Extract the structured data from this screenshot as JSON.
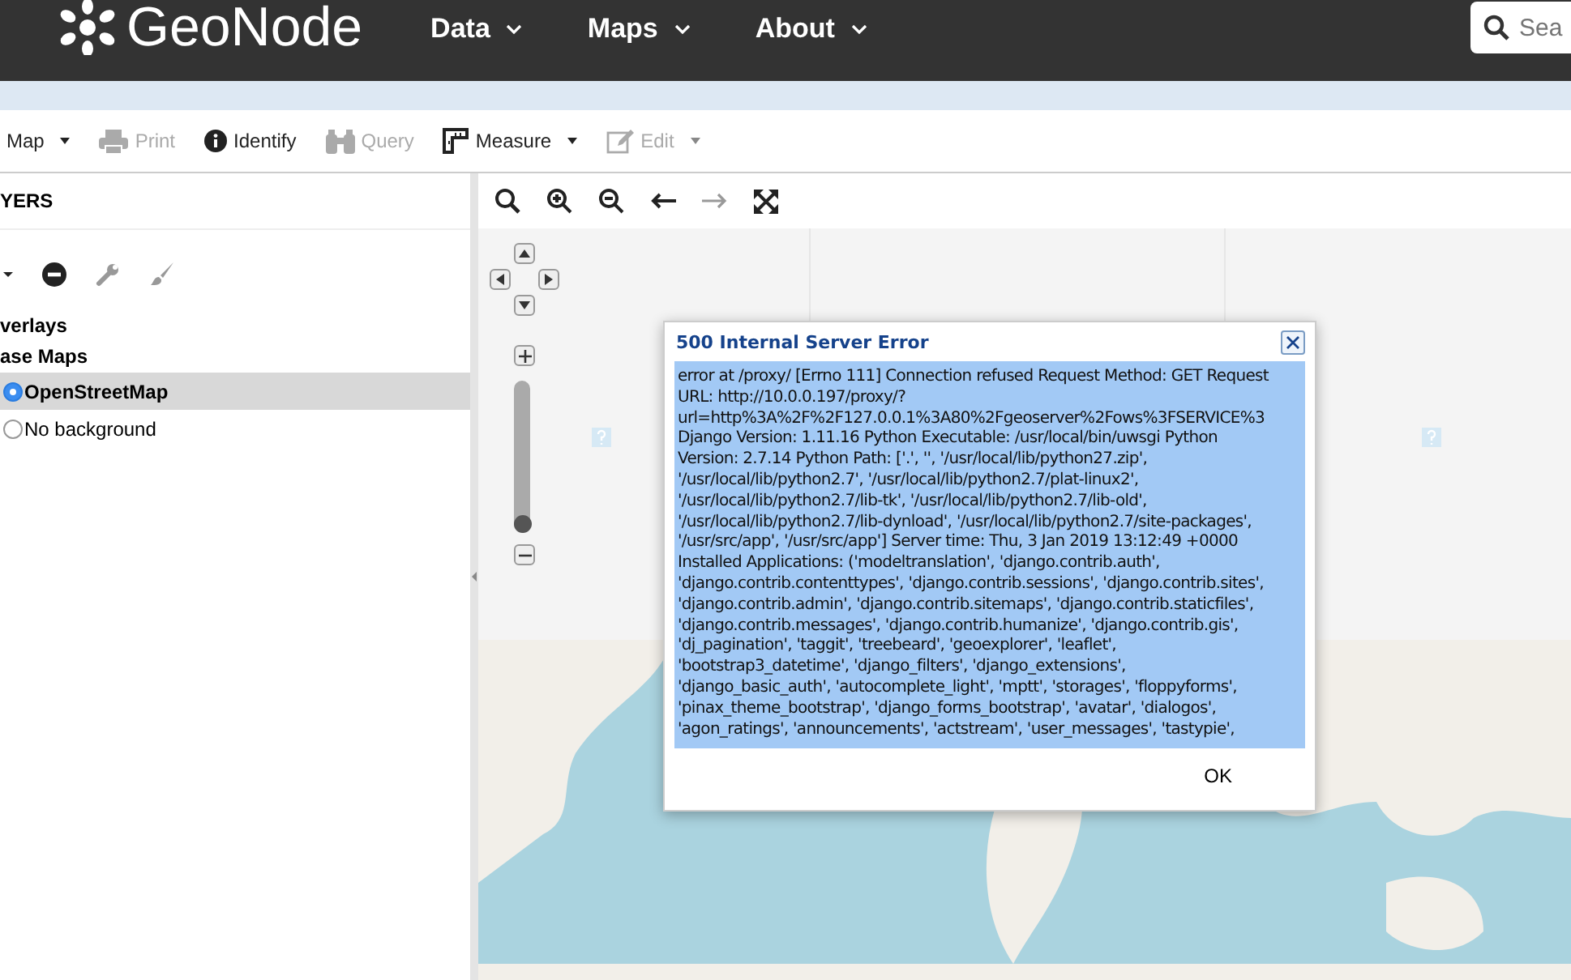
{
  "nav": {
    "brand": "GeoNode",
    "menus": [
      {
        "label": "Data"
      },
      {
        "label": "Maps"
      },
      {
        "label": "About"
      }
    ],
    "search": {
      "placeholder": "Sea"
    }
  },
  "toolbar": [
    {
      "label": "Map",
      "dropdown": true,
      "disabled": false
    },
    {
      "label": "Print",
      "dropdown": false,
      "disabled": true
    },
    {
      "label": "Identify",
      "dropdown": false,
      "disabled": false
    },
    {
      "label": "Query",
      "dropdown": false,
      "disabled": true
    },
    {
      "label": "Measure",
      "dropdown": true,
      "disabled": false
    },
    {
      "label": "Edit",
      "dropdown": true,
      "disabled": true
    }
  ],
  "layers": {
    "title": "YERS",
    "groups": [
      {
        "label": "verlays"
      },
      {
        "label": "ase Maps",
        "children": [
          {
            "label": "OpenStreetMap",
            "selected": true
          },
          {
            "label": "No background",
            "selected": false
          }
        ]
      }
    ]
  },
  "map": {
    "zoom_slider": {
      "level": 0
    }
  },
  "dialog": {
    "title": "500 Internal Server Error",
    "lines": [
      "error at /proxy/ [Errno 111] Connection refused Request Method: GET Request",
      "URL: http://10.0.0.197/proxy/?",
      "url=http%3A%2F%2F127.0.0.1%3A80%2Fgeoserver%2Fows%3FSERVICE%3",
      "Django Version: 1.11.16 Python Executable: /usr/local/bin/uwsgi Python",
      "Version: 2.7.14 Python Path: ['.', '', '/usr/local/lib/python27.zip',",
      "'/usr/local/lib/python2.7', '/usr/local/lib/python2.7/plat-linux2',",
      "'/usr/local/lib/python2.7/lib-tk', '/usr/local/lib/python2.7/lib-old',",
      "'/usr/local/lib/python2.7/lib-dynload', '/usr/local/lib/python2.7/site-packages',",
      "'/usr/src/app', '/usr/src/app'] Server time: Thu, 3 Jan 2019 13:12:49 +0000",
      "Installed Applications: ('modeltranslation', 'django.contrib.auth',",
      "'django.contrib.contenttypes', 'django.contrib.sessions', 'django.contrib.sites',",
      "'django.contrib.admin', 'django.contrib.sitemaps', 'django.contrib.staticfiles',",
      "'django.contrib.messages', 'django.contrib.humanize', 'django.contrib.gis',",
      "'dj_pagination', 'taggit', 'treebeard', 'geoexplorer', 'leaflet',",
      "'bootstrap3_datetime', 'django_filters', 'django_extensions',",
      "'django_basic_auth', 'autocomplete_light', 'mptt', 'storages', 'floppyforms',",
      "'pinax_theme_bootstrap', 'django_forms_bootstrap', 'avatar', 'dialogos',",
      "'agon_ratings', 'announcements', 'actstream', 'user_messages', 'tastypie',"
    ],
    "button": "OK"
  }
}
